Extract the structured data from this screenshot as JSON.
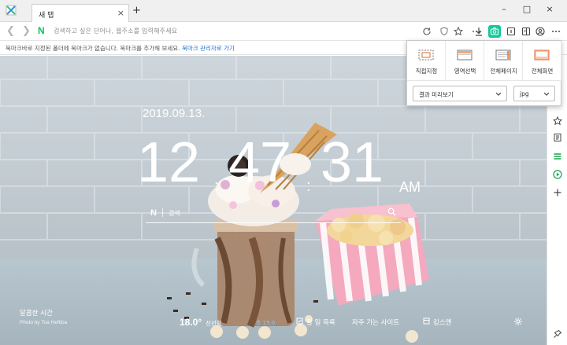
{
  "browser": {
    "tab_title": "새 탭",
    "tab_close": "×",
    "new_tab": "+",
    "window_buttons": [
      "–",
      "□",
      "×"
    ],
    "omnibox_placeholder": "검색하고 싶은 단어나, 웹주소를 입력해주세요",
    "bookmark_hint": "북마크바로 지정된 폴더에 북마크가 없습니다. 북마크를 추가해 보세요.",
    "bookmark_link": "북마크 관리자로 가기"
  },
  "capture_popup": {
    "options": [
      {
        "label": "직접지정",
        "icon": "capture-custom-icon"
      },
      {
        "label": "영역선택",
        "icon": "capture-area-icon"
      },
      {
        "label": "전체페이지",
        "icon": "capture-page-icon"
      },
      {
        "label": "전체화면",
        "icon": "capture-screen-icon"
      }
    ],
    "action_select": "결과 미리보기",
    "format_select": "jpg"
  },
  "newtab": {
    "date": "2019.09.13.",
    "clock": {
      "hh": "12",
      "mm": "47",
      "ss": "31",
      "ampm": "AM"
    },
    "search_label": "검색",
    "caption_title": "달콤한 시간",
    "caption_credit": "Photo by Toa Heftiba",
    "weather_temp": "18.0°",
    "weather_desc": "선선함",
    "dust": "초 15.0",
    "links": [
      "할 일 목록",
      "자주 가는 사이트",
      "킹스맨"
    ]
  },
  "colors": {
    "naver_green": "#03c75a",
    "capture_active": "#16c795",
    "link_blue": "#1f6fd1"
  }
}
